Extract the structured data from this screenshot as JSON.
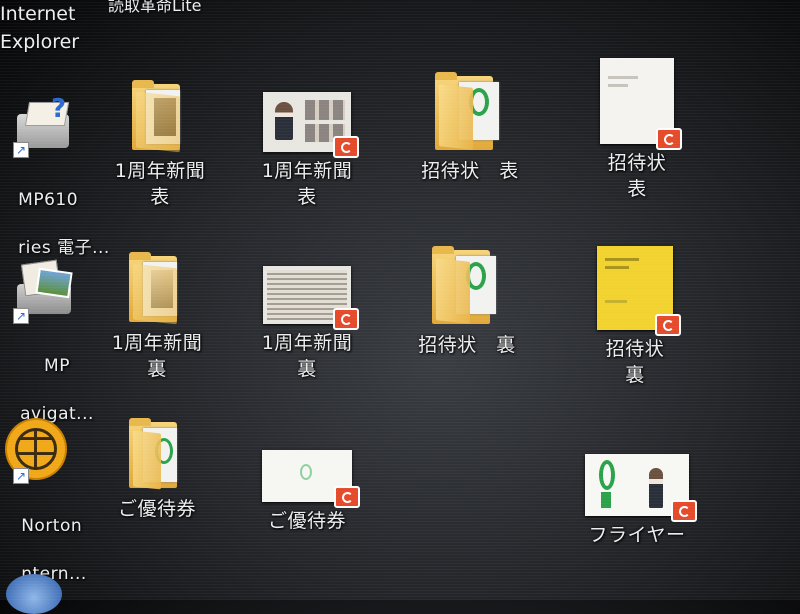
{
  "desktop": {
    "top_partial_text": "読取革命Lite",
    "left_column": [
      {
        "label_lines": [
          "Internet",
          "Explorer"
        ],
        "icon": "internet-explorer-icon"
      },
      {
        "label_lines": [
          "MP610",
          "ries 電子..."
        ],
        "icon": "mp610-manual-icon"
      },
      {
        "label_lines": [
          "MP",
          "avigat..."
        ],
        "icon": "mp-navigator-icon"
      },
      {
        "label_lines": [
          "Norton",
          "ntern..."
        ],
        "icon": "norton-globe-icon"
      }
    ],
    "icons": [
      {
        "label": "1周年新聞\n表",
        "type": "folder"
      },
      {
        "label": "1周年新聞\n表",
        "type": "document"
      },
      {
        "label": "招待状　表",
        "type": "folder"
      },
      {
        "label": "招待状\n表",
        "type": "document"
      },
      {
        "label": "1周年新聞\n裏",
        "type": "folder"
      },
      {
        "label": "1周年新聞\n裏",
        "type": "document"
      },
      {
        "label": "招待状　裏",
        "type": "folder"
      },
      {
        "label": "招待状\n裏",
        "type": "document"
      },
      {
        "label": "ご優待券",
        "type": "folder"
      },
      {
        "label": "ご優待券",
        "type": "document"
      },
      {
        "label": "フライヤー",
        "type": "document"
      }
    ]
  },
  "colors": {
    "folder": "#f0c25a",
    "badge": "#e54a2a",
    "green_logo": "#2aa24a",
    "yellow_doc": "#f2d22e"
  }
}
